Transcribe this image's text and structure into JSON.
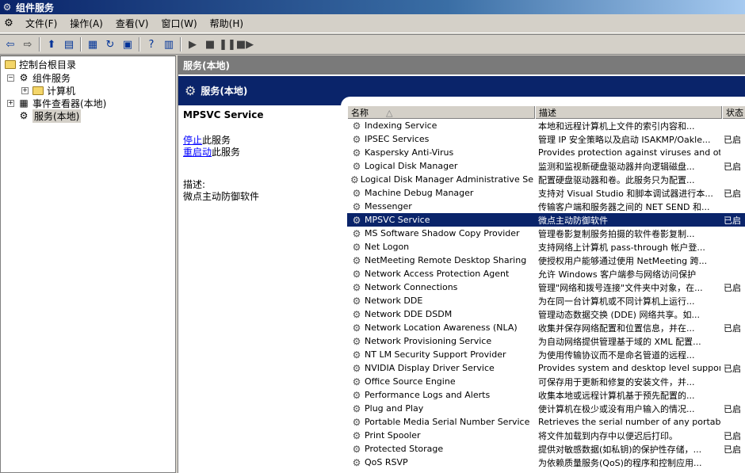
{
  "window": {
    "title": "组件服务"
  },
  "menu": [
    "文件(F)",
    "操作(A)",
    "查看(V)",
    "窗口(W)",
    "帮助(H)"
  ],
  "tree": {
    "root": "控制台根目录",
    "items": [
      {
        "label": "组件服务"
      },
      {
        "label": "计算机"
      },
      {
        "label": "事件查看器(本地)"
      },
      {
        "label": "服务(本地)"
      }
    ]
  },
  "right": {
    "header": "服务(本地)",
    "band_title": "服务(本地)",
    "detail": {
      "service_name": "MPSVC Service",
      "stop_link": "停止",
      "stop_suffix": "此服务",
      "restart_link": "重启动",
      "restart_suffix": "此服务",
      "desc_label": "描述:",
      "desc_text": "微点主动防御软件"
    },
    "columns": {
      "name": "名称",
      "description": "描述",
      "status": "状态"
    },
    "rows": [
      {
        "name": "Indexing Service",
        "description": "本地和远程计算机上文件的索引内容和...",
        "status": ""
      },
      {
        "name": "IPSEC Services",
        "description": "管理 IP 安全策略以及启动 ISAKMP/Oakle...",
        "status": "已启"
      },
      {
        "name": "Kaspersky Anti-Virus",
        "description": "Provides protection against viruses and oth...",
        "status": ""
      },
      {
        "name": "Logical Disk Manager",
        "description": "监测和监视新硬盘驱动器并向逻辑磁盘...",
        "status": "已启"
      },
      {
        "name": "Logical Disk Manager Administrative Service",
        "description": "配置硬盘驱动器和卷。此服务只为配置...",
        "status": ""
      },
      {
        "name": "Machine Debug Manager",
        "description": "支持对 Visual Studio 和脚本调试器进行本...",
        "status": "已启"
      },
      {
        "name": "Messenger",
        "description": "传输客户端和服务器之间的 NET SEND 和...",
        "status": ""
      },
      {
        "name": "MPSVC Service",
        "description": "微点主动防御软件",
        "status": "已启",
        "selected": true
      },
      {
        "name": "MS Software Shadow Copy Provider",
        "description": "管理卷影复制服务拍摄的软件卷影复制...",
        "status": ""
      },
      {
        "name": "Net Logon",
        "description": "支持网络上计算机 pass-through 帐户登...",
        "status": ""
      },
      {
        "name": "NetMeeting Remote Desktop Sharing",
        "description": "使授权用户能够通过使用 NetMeeting 跨...",
        "status": ""
      },
      {
        "name": "Network Access Protection Agent",
        "description": "允许 Windows 客户端参与网络访问保护",
        "status": ""
      },
      {
        "name": "Network Connections",
        "description": "管理\"网络和拨号连接\"文件夹中对象，在...",
        "status": "已启"
      },
      {
        "name": "Network DDE",
        "description": "为在同一台计算机或不同计算机上运行...",
        "status": ""
      },
      {
        "name": "Network DDE DSDM",
        "description": "管理动态数据交换 (DDE) 网络共享。如...",
        "status": ""
      },
      {
        "name": "Network Location Awareness (NLA)",
        "description": "收集并保存网络配置和位置信息，并在...",
        "status": "已启"
      },
      {
        "name": "Network Provisioning Service",
        "description": "为自动网络提供管理基于域的 XML 配置...",
        "status": ""
      },
      {
        "name": "NT LM Security Support Provider",
        "description": "为使用传输协议而不是命名管道的远程...",
        "status": ""
      },
      {
        "name": "NVIDIA Display Driver Service",
        "description": "Provides system and desktop level support t...",
        "status": "已启"
      },
      {
        "name": "Office Source Engine",
        "description": "可保存用于更新和修复的安装文件，并...",
        "status": ""
      },
      {
        "name": "Performance Logs and Alerts",
        "description": "收集本地或远程计算机基于预先配置的...",
        "status": ""
      },
      {
        "name": "Plug and Play",
        "description": "使计算机在极少或没有用户输入的情况...",
        "status": "已启"
      },
      {
        "name": "Portable Media Serial Number Service",
        "description": "Retrieves the serial number of any portable ...",
        "status": ""
      },
      {
        "name": "Print Spooler",
        "description": "将文件加载到内存中以便迟后打印。",
        "status": "已启"
      },
      {
        "name": "Protected Storage",
        "description": "提供对敏感数据(如私钥)的保护性存储，...",
        "status": "已启"
      },
      {
        "name": "QoS RSVP",
        "description": "为依赖质量服务(QoS)的程序和控制应用...",
        "status": ""
      }
    ]
  }
}
